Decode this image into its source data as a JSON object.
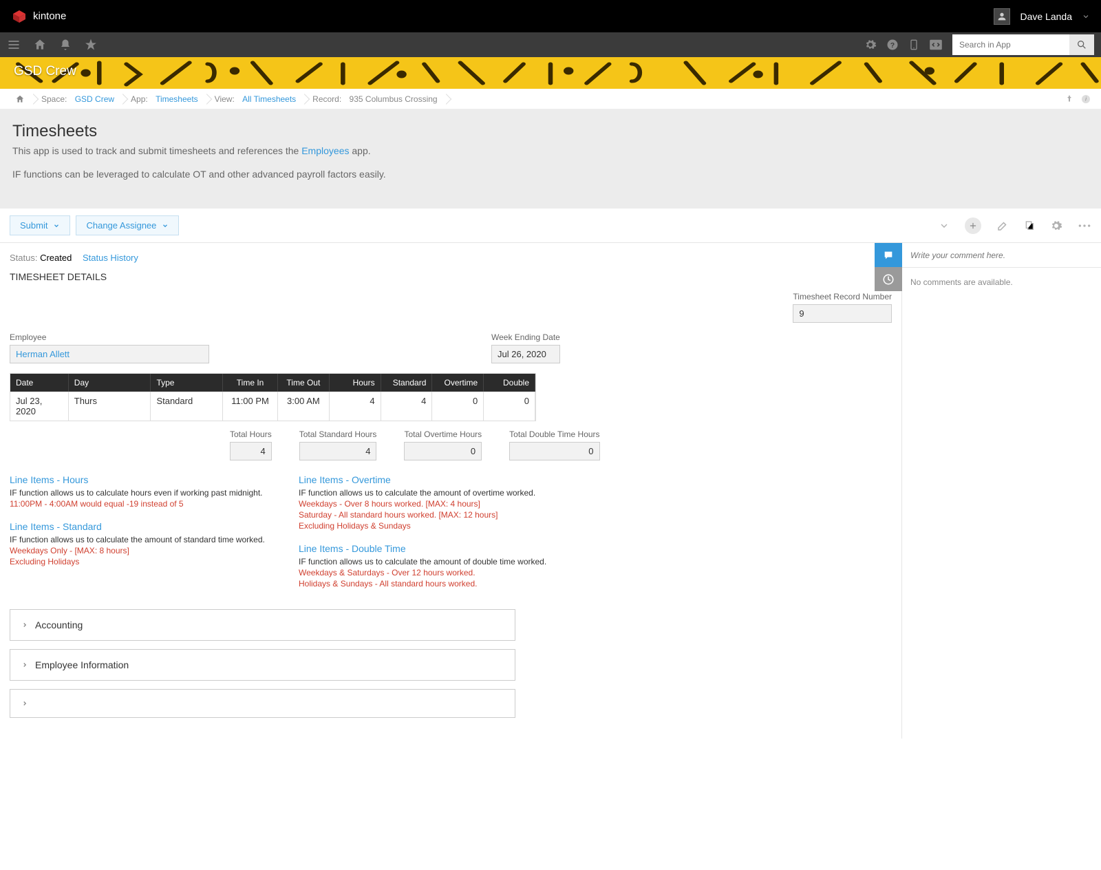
{
  "brand": "kintone",
  "user": {
    "name": "Dave Landa"
  },
  "search": {
    "placeholder": "Search in App"
  },
  "banner": {
    "title": "GSD Crew"
  },
  "breadcrumb": {
    "space_lbl": "Space:",
    "space": "GSD Crew",
    "app_lbl": "App:",
    "app": "Timesheets",
    "view_lbl": "View:",
    "view": "All Timesheets",
    "record_lbl": "Record:",
    "record": "935 Columbus Crossing"
  },
  "header": {
    "title": "Timesheets",
    "desc_pre": "This app is used to track and submit timesheets and references the ",
    "desc_link": "Employees",
    "desc_post": " app.",
    "desc2": "IF functions can be leveraged to calculate OT and other advanced payroll factors easily."
  },
  "actions": {
    "submit": "Submit",
    "change": "Change Assignee"
  },
  "status": {
    "label": "Status:",
    "value": "Created",
    "history": "Status History"
  },
  "section": "TIMESHEET DETAILS",
  "fields": {
    "recno_lbl": "Timesheet Record Number",
    "recno": "9",
    "emp_lbl": "Employee",
    "emp": "Herman Allett",
    "week_lbl": "Week Ending Date",
    "week": "Jul 26, 2020"
  },
  "table": {
    "headers": {
      "date": "Date",
      "day": "Day",
      "type": "Type",
      "in": "Time In",
      "out": "Time Out",
      "hours": "Hours",
      "std": "Standard",
      "ot": "Overtime",
      "dbl": "Double"
    },
    "row": {
      "date": "Jul 23, 2020",
      "day": "Thurs",
      "type": "Standard",
      "in": "11:00 PM",
      "out": "3:00 AM",
      "hours": "4",
      "std": "4",
      "ot": "0",
      "dbl": "0"
    }
  },
  "totals": {
    "th_lbl": "Total Hours",
    "th": "4",
    "ts_lbl": "Total Standard Hours",
    "ts": "4",
    "to_lbl": "Total Overtime Hours",
    "to": "0",
    "td_lbl": "Total Double Time Hours",
    "td": "0"
  },
  "notes": {
    "hours_t": "Line Items - Hours",
    "hours_1": "IF function allows us to calculate hours even if working past midnight.",
    "hours_2": "11:00PM - 4:00AM would equal -19 instead of 5",
    "std_t": "Line Items - Standard",
    "std_1": "IF function allows us to calculate the amount of standard time worked.",
    "std_2": "Weekdays Only - [MAX: 8 hours]",
    "std_3": "Excluding Holidays",
    "ot_t": "Line Items - Overtime",
    "ot_1": "IF function allows us to calculate the amount of overtime worked.",
    "ot_2": "Weekdays - Over 8 hours worked. [MAX: 4 hours]",
    "ot_3": "Saturday - All standard hours worked. [MAX: 12 hours]",
    "ot_4": "Excluding Holidays & Sundays",
    "dbl_t": "Line Items - Double Time",
    "dbl_1": "IF function allows us to calculate the amount of double time worked.",
    "dbl_2": "Weekdays & Saturdays - Over 12 hours worked.",
    "dbl_3": "Holidays & Sundays - All standard hours worked."
  },
  "groups": {
    "acct": "Accounting",
    "emp": "Employee Information"
  },
  "comments": {
    "placeholder": "Write your comment here.",
    "empty": "No comments are available."
  }
}
